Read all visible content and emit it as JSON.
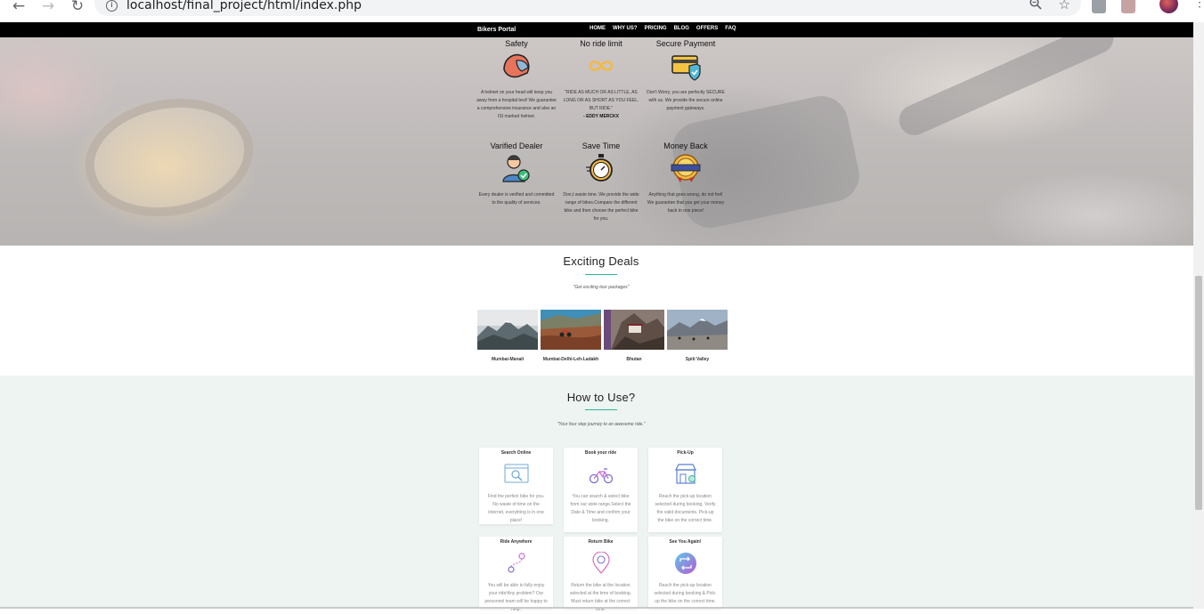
{
  "browser": {
    "url": "localhost/final_project/html/index.php",
    "icons": [
      "back-icon",
      "forward-icon",
      "reload-icon",
      "info-icon",
      "zoom-out-icon",
      "star-icon",
      "kebab-menu-icon"
    ]
  },
  "navbar": {
    "brand": "Bikers Portal",
    "menu": [
      "HOME",
      "WHY US?",
      "PRICING",
      "BLOG",
      "OFFERS",
      "FAQ"
    ]
  },
  "features": [
    {
      "title": "Safety",
      "icon": "helmet-icon",
      "desc": "A helmet on your head will keep you away from a hospital bed! We guarantee a comprehensive insurance and also an ISI marked helmet.",
      "author": ""
    },
    {
      "title": "No ride limit",
      "icon": "infinity-icon",
      "desc": "\"RIDE AS MUCH OR AS LITTLE, AS LONG OR AS SHORT AS YOU FEEL. BUT RIDE.\"",
      "author": "- EDDY MERCKX"
    },
    {
      "title": "Secure Payment",
      "icon": "secure-card-icon",
      "desc": "Don't Worry, you are perfectly SECURE with us. We provide the secure online payment gateways.",
      "author": ""
    },
    {
      "title": "Varified Dealer",
      "icon": "verified-dealer-icon",
      "desc": "Every dealer is verified and committed to the quality of services.",
      "author": ""
    },
    {
      "title": "Save Time",
      "icon": "stopwatch-icon",
      "desc": "Don,t waste time. We provide the wide range of bikes.Compare the different bike and then choose the perfect bike for you.",
      "author": ""
    },
    {
      "title": "Money Back",
      "icon": "money-back-badge-icon",
      "desc": "Anything that goes wrong, do not fret! We guarantee that you get your money back in one piece!",
      "author": ""
    }
  ],
  "deals": {
    "title": "Exciting Deals",
    "subtitle": "\"Get exciting tour packages\"",
    "items": [
      {
        "label": "Mumbai-Manali"
      },
      {
        "label": "Mumbai-Delhi-Leh-Ladakh"
      },
      {
        "label": "Bhutan"
      },
      {
        "label": "Spiti Valley"
      }
    ]
  },
  "howto": {
    "title": "How to Use?",
    "subtitle": "\"Your four step journey to an awesome ride.\"",
    "steps": [
      {
        "title": "Search Online",
        "icon": "search-browser-icon",
        "desc": "Find the perfect bike for you. No waste of time on the internet, everything is in one place!"
      },
      {
        "title": "Book your ride",
        "icon": "motorbike-icon",
        "desc": "You can search & select bike from our wide range.Select the Date & Time and confirm your booking."
      },
      {
        "title": "Pick-Up",
        "icon": "store-location-icon",
        "desc": "Reach the pick-up location selected during booking. Verify the valid documents. Pick-up the bike on the correct time."
      },
      {
        "title": "Ride Anywhere",
        "icon": "route-icon",
        "desc": "You will be able to fully enjoy your ride!Any problem? Our personnel team will be happy to help."
      },
      {
        "title": "Return Bike",
        "icon": "location-pin-icon",
        "desc": "Return the bike at the location selected at the time of booking. Must return bike at the correct time."
      },
      {
        "title": "See You Again!",
        "icon": "repeat-icon",
        "desc": "Reach the pick-up location selected during booking & Pick-up the bike on the correct time."
      }
    ]
  },
  "colors": {
    "accent": "#2bb89a",
    "navbar": "#000000",
    "howto_bg": "#eef4f1"
  }
}
